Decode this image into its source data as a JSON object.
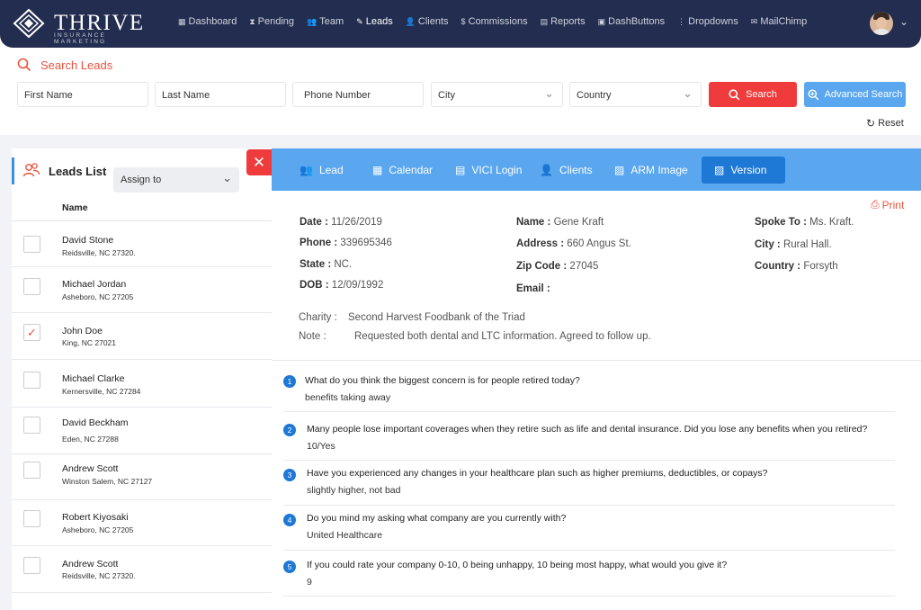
{
  "brand": {
    "name": "THRIVE",
    "tagline": "INSURANCE MARKETING"
  },
  "nav": [
    {
      "icon": "▦",
      "label": "Dashboard"
    },
    {
      "icon": "⧗",
      "label": "Pending"
    },
    {
      "icon": "👥",
      "label": "Team"
    },
    {
      "icon": "✎",
      "label": "Leads",
      "active": true
    },
    {
      "icon": "👤",
      "label": "Clients"
    },
    {
      "icon": "$",
      "label": "Commissions"
    },
    {
      "icon": "▤",
      "label": "Reports"
    },
    {
      "icon": "▣",
      "label": "DashButtons"
    },
    {
      "icon": "⋮",
      "label": "Dropdowns"
    },
    {
      "icon": "✉",
      "label": "MailChimp"
    }
  ],
  "search": {
    "title": "Search Leads",
    "first_name": "First Name",
    "last_name": "Last Name",
    "phone": "Phone Number",
    "city": "City",
    "country": "Country",
    "search_button": "Search",
    "advanced_button": "Advanced Search",
    "reset": "Reset"
  },
  "leads": {
    "title": "Leads List",
    "assign": "Assign to",
    "column_name": "Name",
    "items": [
      {
        "name": "David Stone",
        "location": "Reidsville, NC 27320.",
        "checked": false
      },
      {
        "name": "Michael Jordan",
        "location": "Asheboro, NC 27205",
        "checked": false
      },
      {
        "name": "John Doe",
        "location": "King, NC 27021",
        "checked": true
      },
      {
        "name": "Michael Clarke",
        "location": "Kernersville, NC 27284",
        "checked": false
      },
      {
        "name": "David Beckham",
        "location": "Eden, NC 27288",
        "checked": false
      },
      {
        "name": "Andrew Scott",
        "location": "Winston Salem, NC 27127",
        "checked": false
      },
      {
        "name": "Robert Kiyosaki",
        "location": "Asheboro, NC 27205",
        "checked": false
      },
      {
        "name": "Andrew Scott",
        "location": "Reidsville, NC 27320.",
        "checked": false
      }
    ]
  },
  "tabs": [
    {
      "icon": "👥",
      "label": "Lead"
    },
    {
      "icon": "▦",
      "label": "Calendar"
    },
    {
      "icon": "▤",
      "label": "VICI Login"
    },
    {
      "icon": "👤",
      "label": "Clients"
    },
    {
      "icon": "▨",
      "label": "ARM Image"
    },
    {
      "icon": "▨",
      "label": "Version",
      "active": true
    }
  ],
  "detail": {
    "print": "Print",
    "date_label": "Date :",
    "date": "11/26/2019",
    "phone_label": "Phone :",
    "phone": "339695346",
    "state_label": "State :",
    "state": "NC.",
    "dob_label": "DOB :",
    "dob": "12/09/1992",
    "name_label": "Name :",
    "name": "Gene Kraft",
    "address_label": "Address :",
    "address": "660 Angus St.",
    "zip_label": "Zip Code :",
    "zip": "27045",
    "email_label": "Email :",
    "email": "",
    "spoke_label": "Spoke To :",
    "spoke": "Ms. Kraft.",
    "city_label": "City :",
    "city": "Rural Hall.",
    "country_label": "Country :",
    "country": "Forsyth",
    "charity_label": "Charity :",
    "charity": "Second Harvest Foodbank of the Triad",
    "note_label": "Note :",
    "note": "Requested both dental and LTC information. Agreed to follow up."
  },
  "questions": [
    {
      "num": "1",
      "q": "What do you think the biggest concern is for people retired today?",
      "a": "benefits taking away"
    },
    {
      "num": "2",
      "q": "Many people lose important coverages when they retire such as life and dental insurance. Did you lose any benefits when you retired?",
      "a": "10/Yes"
    },
    {
      "num": "3",
      "q": "Have you experienced any changes in your healthcare plan such as higher premiums, deductibles, or copays?",
      "a": "slightly higher, not bad"
    },
    {
      "num": "4",
      "q": "Do you mind my asking what company are you currently with?",
      "a": "United Healthcare"
    },
    {
      "num": "5",
      "q": "If you could rate your company 0-10, 0 being unhappy, 10 being most happy, what would you give it?",
      "a": "9"
    }
  ]
}
